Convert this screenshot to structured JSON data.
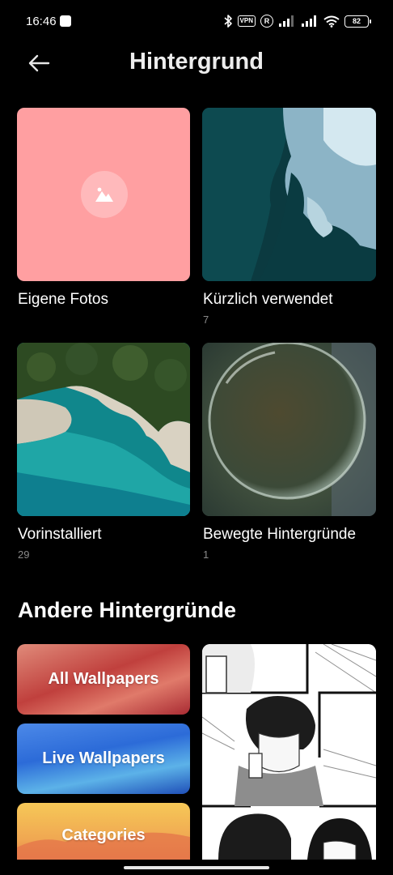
{
  "status_bar": {
    "time": "16:46",
    "vpn": "VPN",
    "roaming": "R",
    "battery": "82"
  },
  "header": {
    "title": "Hintergrund",
    "back_icon": "arrow-left-icon"
  },
  "tiles": [
    {
      "label": "Eigene Fotos",
      "count": "",
      "icon": "image-icon",
      "color": "#ff9fa1"
    },
    {
      "label": "Kürzlich verwendet",
      "count": "7"
    },
    {
      "label": "Vorinstalliert",
      "count": "29"
    },
    {
      "label": "Bewegte Hintergründe",
      "count": "1"
    }
  ],
  "other": {
    "title": "Andere Hintergründe",
    "cards": [
      {
        "label": "All Wallpapers"
      },
      {
        "label": "Live Wallpapers"
      },
      {
        "label": "Categories"
      }
    ]
  },
  "colors": {
    "background": "#000000",
    "text": "#ffffff",
    "count": "#8a8a8a"
  }
}
